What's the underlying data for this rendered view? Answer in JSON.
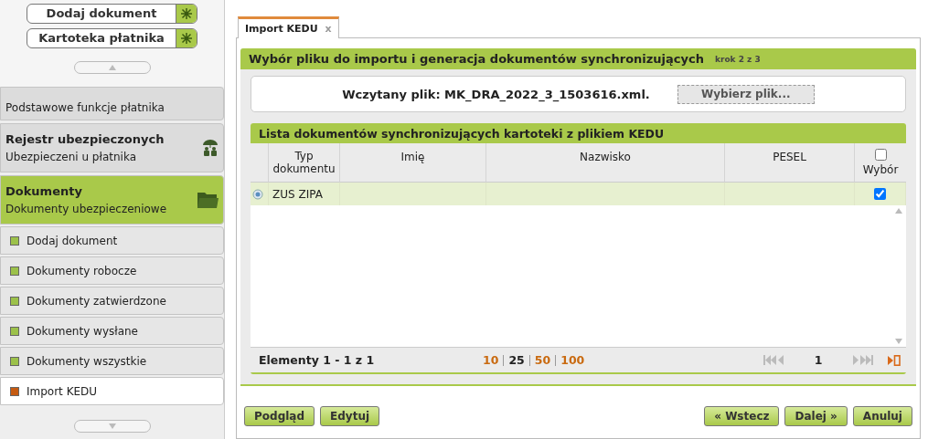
{
  "quick_actions": [
    {
      "label": "Dodaj dokument"
    },
    {
      "label": "Kartoteka płatnika"
    }
  ],
  "sidebar": {
    "groups": [
      {
        "subtitle": "Podstawowe funkcje płatnika",
        "selected": false
      },
      {
        "title": "Rejestr ubezpieczonych",
        "subtitle": "Ubezpieczeni u płatnika",
        "selected": false
      },
      {
        "title": "Dokumenty",
        "subtitle": "Dokumenty ubezpieczeniowe",
        "selected": true
      }
    ],
    "items": [
      {
        "label": "Dodaj dokument",
        "selected": false
      },
      {
        "label": "Dokumenty robocze",
        "selected": false
      },
      {
        "label": "Dokumenty zatwierdzone",
        "selected": false
      },
      {
        "label": "Dokumenty wysłane",
        "selected": false
      },
      {
        "label": "Dokumenty wszystkie",
        "selected": false
      },
      {
        "label": "Import KEDU",
        "selected": true
      }
    ]
  },
  "tabs": [
    {
      "label": "Import KEDU",
      "selected": true,
      "close": "x"
    }
  ],
  "wizard": {
    "title": "Wybór pliku do importu i generacja dokumentów synchronizujących",
    "step": "krok 2 z 3",
    "file_label": "Wczytany plik: MK_DRA_2022_3_1503616.xml.",
    "choose_button": "Wybierz plik..."
  },
  "table": {
    "title": "Lista dokumentów synchronizujących kartoteki z plikiem KEDU",
    "columns": [
      "Typ dokumentu",
      "Imię",
      "Nazwisko",
      "PESEL",
      "Wybór"
    ],
    "select_all_checked": false,
    "rows": [
      {
        "cells": [
          "ZUS ZIPA",
          "",
          "",
          ""
        ],
        "selected": true,
        "checked": true
      }
    ],
    "summary": "Elementy 1 - 1 z 1",
    "page_sizes": [
      {
        "label": "10",
        "selected": false
      },
      {
        "label": "25",
        "selected": true
      },
      {
        "label": "50",
        "selected": false
      },
      {
        "label": "100",
        "selected": false
      }
    ],
    "page": "1"
  },
  "buttons_left": [
    "Podgląd",
    "Edytuj"
  ],
  "buttons_right": [
    "« Wstecz",
    "Dalej »",
    "Anuluj"
  ]
}
